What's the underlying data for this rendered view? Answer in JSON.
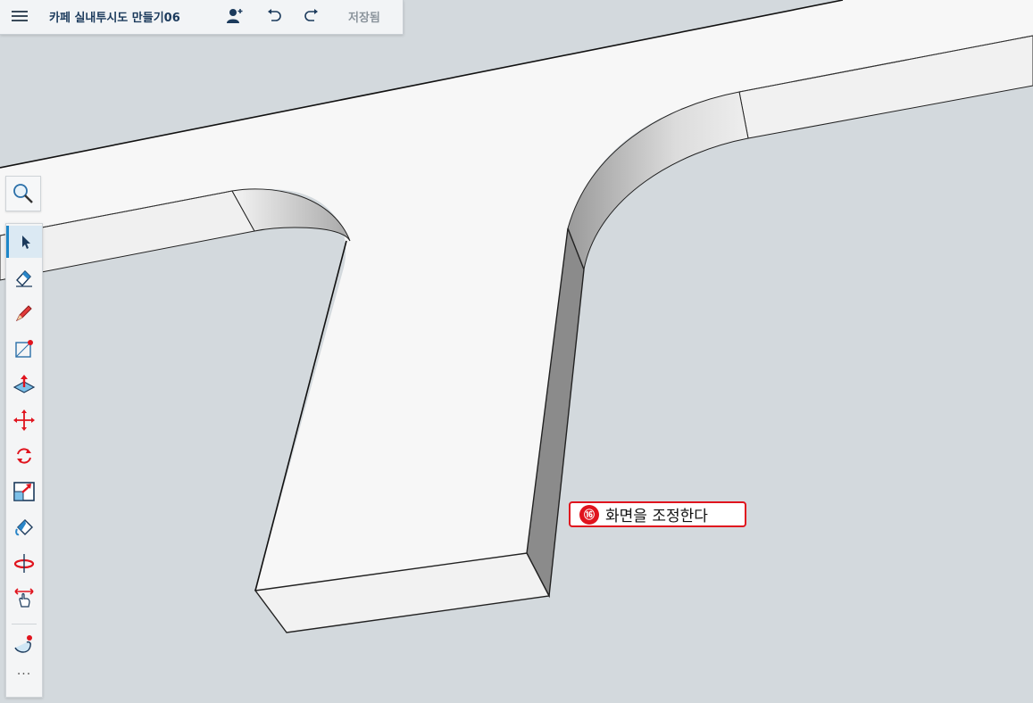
{
  "topbar": {
    "menu_icon": "hamburger-menu-icon",
    "title": "카페 실내투시도 만들기06",
    "share_icon": "add-user-icon",
    "undo_icon": "undo-icon",
    "redo_icon": "redo-icon",
    "saved_label": "저장됨"
  },
  "toolbar": {
    "search_icon": "search-icon",
    "tools": [
      {
        "name": "select",
        "icon": "arrow-cursor-icon",
        "active": true
      },
      {
        "name": "eraser",
        "icon": "eraser-icon"
      },
      {
        "name": "pencil",
        "icon": "pencil-icon"
      },
      {
        "name": "rectangle",
        "icon": "rectangle-icon"
      },
      {
        "name": "push-pull",
        "icon": "push-pull-icon"
      },
      {
        "name": "move",
        "icon": "move-icon"
      },
      {
        "name": "rotate",
        "icon": "rotate-icon"
      },
      {
        "name": "scale",
        "icon": "scale-icon"
      },
      {
        "name": "paint-bucket",
        "icon": "paint-bucket-icon"
      },
      {
        "name": "orbit",
        "icon": "orbit-icon"
      },
      {
        "name": "pan",
        "icon": "pan-hand-icon"
      },
      {
        "name": "follow-me",
        "icon": "follow-me-icon"
      }
    ],
    "more_label": "···"
  },
  "annotation": {
    "number": "⑯",
    "text": "화면을 조정한다"
  },
  "colors": {
    "background": "#d2d8dc",
    "top_face": "#f7f7f7",
    "callout_red": "#e0141e",
    "accent_blue": "#1d86c8"
  }
}
